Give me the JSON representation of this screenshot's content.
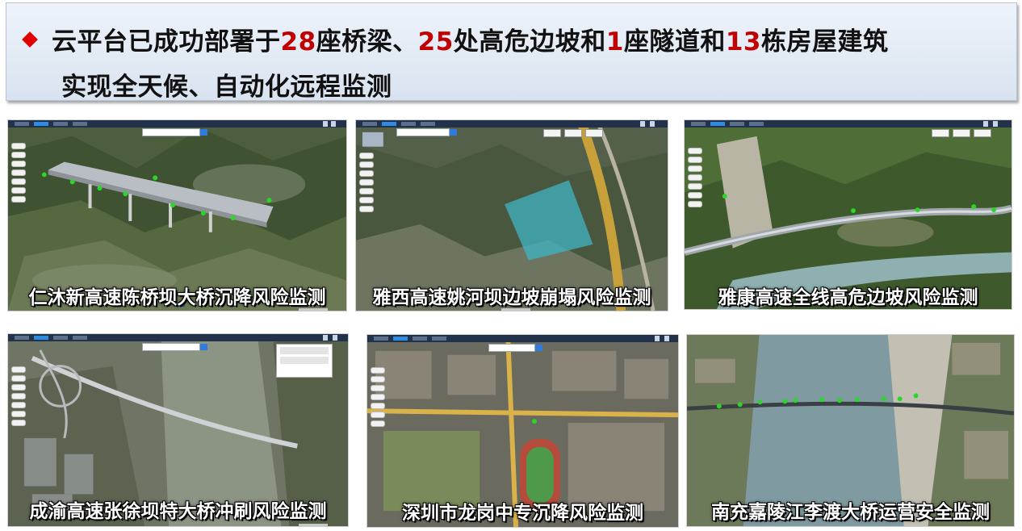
{
  "headline": {
    "line1": {
      "prefix": "云平台已成功部署于",
      "n_bridges": "28",
      "t_bridges": "座桥梁、",
      "n_slopes": "25",
      "t_slopes": "处高危边坡和",
      "n_tunnels": "1",
      "t_tunnels": "座隧道和",
      "n_buildings": "13",
      "t_buildings": "栋房屋建筑"
    },
    "line2": "实现全天候、自动化远程监测",
    "bullet_color": "#e00000",
    "number_color": "#c00000"
  },
  "cases": [
    {
      "caption": "仁沐新高速陈桥坝大桥沉降风险监测"
    },
    {
      "caption": "雅西高速姚河坝边坡崩塌风险监测"
    },
    {
      "caption": "雅康高速全线高危边坡风险监测"
    },
    {
      "caption": "成渝高速张徐坝特大桥冲刷风险监测"
    },
    {
      "caption": "深圳市龙岗中专沉降风险监测"
    },
    {
      "caption": "南充嘉陵江李渡大桥运营安全监测"
    }
  ],
  "icons": {
    "bullet": "red-diamond-icon",
    "sensor": "green-sensor-marker-icon"
  }
}
